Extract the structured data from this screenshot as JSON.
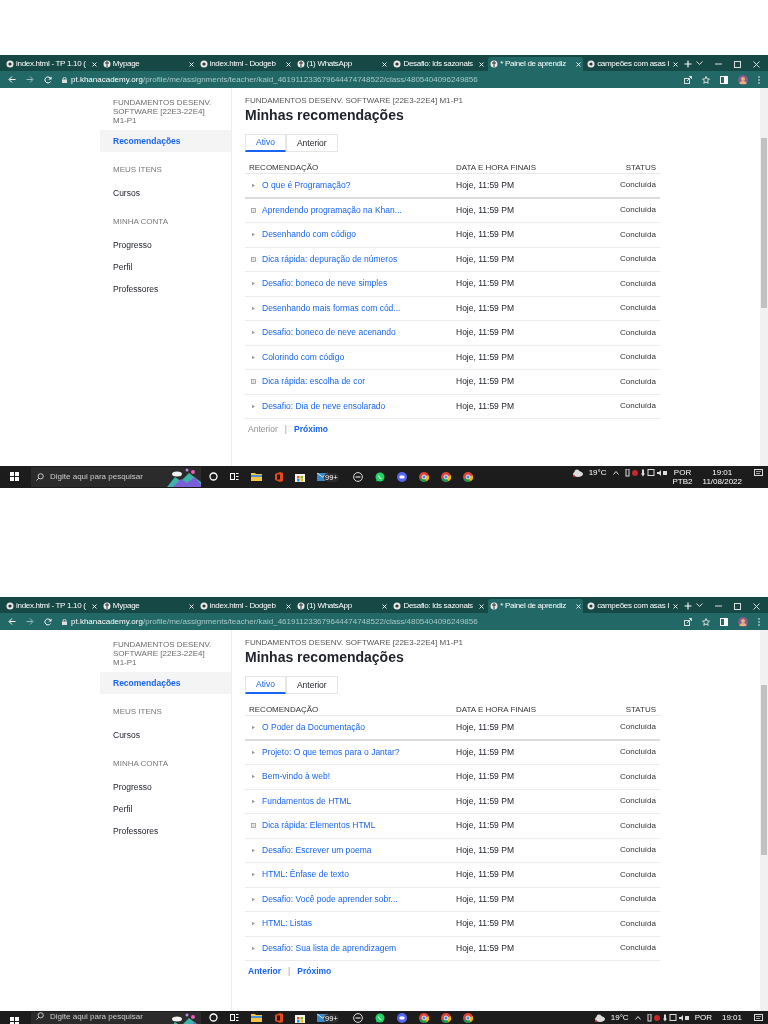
{
  "screenshots": [
    {
      "browser_tabs": [
        {
          "label": "index.html - TP 1.10 (",
          "selected": false
        },
        {
          "label": "Mypage",
          "selected": false
        },
        {
          "label": "index.html - Dodgeb",
          "selected": false
        },
        {
          "label": "(1) WhatsApp",
          "selected": false
        },
        {
          "label": "Desafio: lds sazonais",
          "selected": false
        },
        {
          "label": "* Painel de aprendiz",
          "selected": true
        },
        {
          "label": "campeões com asas I",
          "selected": false
        }
      ],
      "url_host": "pt.khanacademy.org",
      "url_path": "/profile/me/assignments/teacher/kaid_461911233679644474748522/class/4805404096249856",
      "sidebar": {
        "course": "FUNDAMENTOS DESENV. SOFTWARE [22E3-22E4] M1-P1",
        "groups": [
          {
            "items": [
              {
                "label": "Recomendações",
                "selected": true
              }
            ]
          },
          {
            "heading": "MEUS ITENS",
            "items": [
              {
                "label": "Cursos",
                "selected": false
              }
            ]
          },
          {
            "heading": "MINHA CONTA",
            "items": [
              {
                "label": "Progresso",
                "selected": false
              },
              {
                "label": "Perfil",
                "selected": false
              },
              {
                "label": "Professores",
                "selected": false
              }
            ]
          }
        ]
      },
      "main": {
        "course": "FUNDAMENTOS DESENV. SOFTWARE [22E3-22E4] M1-P1",
        "title": "Minhas recomendações",
        "tabs": [
          {
            "label": "Ativo",
            "selected": true
          },
          {
            "label": "Anterior",
            "selected": false
          }
        ],
        "columns": [
          "RECOMENDAÇÃO",
          "DATA E HORA FINAIS",
          "STATUS"
        ],
        "rows": [
          {
            "kind": "video",
            "title": "O que é Programação?",
            "due": "Hoje, 11:59 PM",
            "status": "Concluída"
          },
          {
            "kind": "article",
            "title": "Aprendendo programação na Khan...",
            "due": "Hoje, 11:59 PM",
            "status": "Concluída"
          },
          {
            "kind": "video",
            "title": "Desenhando com código",
            "due": "Hoje, 11:59 PM",
            "status": "Concluída"
          },
          {
            "kind": "article",
            "title": "Dica rápida: depuração de números",
            "due": "Hoje, 11:59 PM",
            "status": "Concluída"
          },
          {
            "kind": "video",
            "title": "Desafio: boneco de neve simples",
            "due": "Hoje, 11:59 PM",
            "status": "Concluída"
          },
          {
            "kind": "video",
            "title": "Desenhando mais formas com cód...",
            "due": "Hoje, 11:59 PM",
            "status": "Concluída"
          },
          {
            "kind": "video",
            "title": "Desafio: boneco de neve acenando",
            "due": "Hoje, 11:59 PM",
            "status": "Concluída"
          },
          {
            "kind": "video",
            "title": "Colorindo com código",
            "due": "Hoje, 11:59 PM",
            "status": "Concluída"
          },
          {
            "kind": "article",
            "title": "Dica rápida: escolha de cor",
            "due": "Hoje, 11:59 PM",
            "status": "Concluída"
          },
          {
            "kind": "video",
            "title": "Desafio: Dia de neve ensolarado",
            "due": "Hoje, 11:59 PM",
            "status": "Concluída"
          }
        ],
        "pagination": [
          {
            "label": "Anterior",
            "disabled": true
          },
          {
            "label": "|"
          },
          {
            "label": "Próximo",
            "disabled": false
          }
        ]
      },
      "taskbar": {
        "search_placeholder": "Digite aqui para pesquisar",
        "mail_badge": "99+",
        "temperature": "19°C",
        "language": "POR",
        "keyboard_layout": "PTB2",
        "time": "19:01",
        "date": "11/08/2022"
      }
    },
    {
      "browser_tabs": [
        {
          "label": "index.html - TP 1.10 (",
          "selected": false
        },
        {
          "label": "Mypage",
          "selected": false
        },
        {
          "label": "index.html - Dodgeb",
          "selected": false
        },
        {
          "label": "(1) WhatsApp",
          "selected": false
        },
        {
          "label": "Desafio: lds sazonais",
          "selected": false
        },
        {
          "label": "* Painel de aprendiz",
          "selected": true
        },
        {
          "label": "campeões com asas I",
          "selected": false
        }
      ],
      "url_host": "pt.khanacademy.org",
      "url_path": "/profile/me/assignments/teacher/kaid_461911233679644474748522/class/4805404096249856",
      "sidebar": {
        "course": "FUNDAMENTOS DESENV. SOFTWARE [22E3-22E4] M1-P1",
        "groups": [
          {
            "items": [
              {
                "label": "Recomendações",
                "selected": true
              }
            ]
          },
          {
            "heading": "MEUS ITENS",
            "items": [
              {
                "label": "Cursos",
                "selected": false
              }
            ]
          },
          {
            "heading": "MINHA CONTA",
            "items": [
              {
                "label": "Progresso",
                "selected": false
              },
              {
                "label": "Perfil",
                "selected": false
              },
              {
                "label": "Professores",
                "selected": false
              }
            ]
          }
        ]
      },
      "main": {
        "course": "FUNDAMENTOS DESENV. SOFTWARE [22E3-22E4] M1-P1",
        "title": "Minhas recomendações",
        "tabs": [
          {
            "label": "Ativo",
            "selected": true
          },
          {
            "label": "Anterior",
            "selected": false
          }
        ],
        "columns": [
          "RECOMENDAÇÃO",
          "DATA E HORA FINAIS",
          "STATUS"
        ],
        "rows": [
          {
            "kind": "video",
            "title": "O Poder da Documentação",
            "due": "Hoje, 11:59 PM",
            "status": "Concluída"
          },
          {
            "kind": "video",
            "title": "Projeto: O que temos para o Jantar?",
            "due": "Hoje, 11:59 PM",
            "status": "Concluída"
          },
          {
            "kind": "video",
            "title": "Bem-vindo à web!",
            "due": "Hoje, 11:59 PM",
            "status": "Concluída"
          },
          {
            "kind": "video",
            "title": "Fundamentos de HTML",
            "due": "Hoje, 11:59 PM",
            "status": "Concluída"
          },
          {
            "kind": "article",
            "title": "Dica rápida: Elementos HTML",
            "due": "Hoje, 11:59 PM",
            "status": "Concluída"
          },
          {
            "kind": "video",
            "title": "Desafio: Escrever um poema",
            "due": "Hoje, 11:59 PM",
            "status": "Concluída"
          },
          {
            "kind": "video",
            "title": "HTML: Ênfase de texto",
            "due": "Hoje, 11:59 PM",
            "status": "Concluída"
          },
          {
            "kind": "video",
            "title": "Desafio: Você pode aprender sobr...",
            "due": "Hoje, 11:59 PM",
            "status": "Concluída"
          },
          {
            "kind": "video",
            "title": "HTML: Listas",
            "due": "Hoje, 11:59 PM",
            "status": "Concluída"
          },
          {
            "kind": "video",
            "title": "Desafio: Sua lista de aprendizagem",
            "due": "Hoje, 11:59 PM",
            "status": "Concluída"
          }
        ],
        "pagination": [
          {
            "label": "Anterior",
            "disabled": false
          },
          {
            "label": "|"
          },
          {
            "label": "Próximo",
            "disabled": false
          }
        ]
      },
      "taskbar": {
        "search_placeholder": "Digite aqui para pesquisar",
        "mail_badge": "99+",
        "temperature": "19°C",
        "language": "POR",
        "time": "19:01"
      }
    }
  ]
}
